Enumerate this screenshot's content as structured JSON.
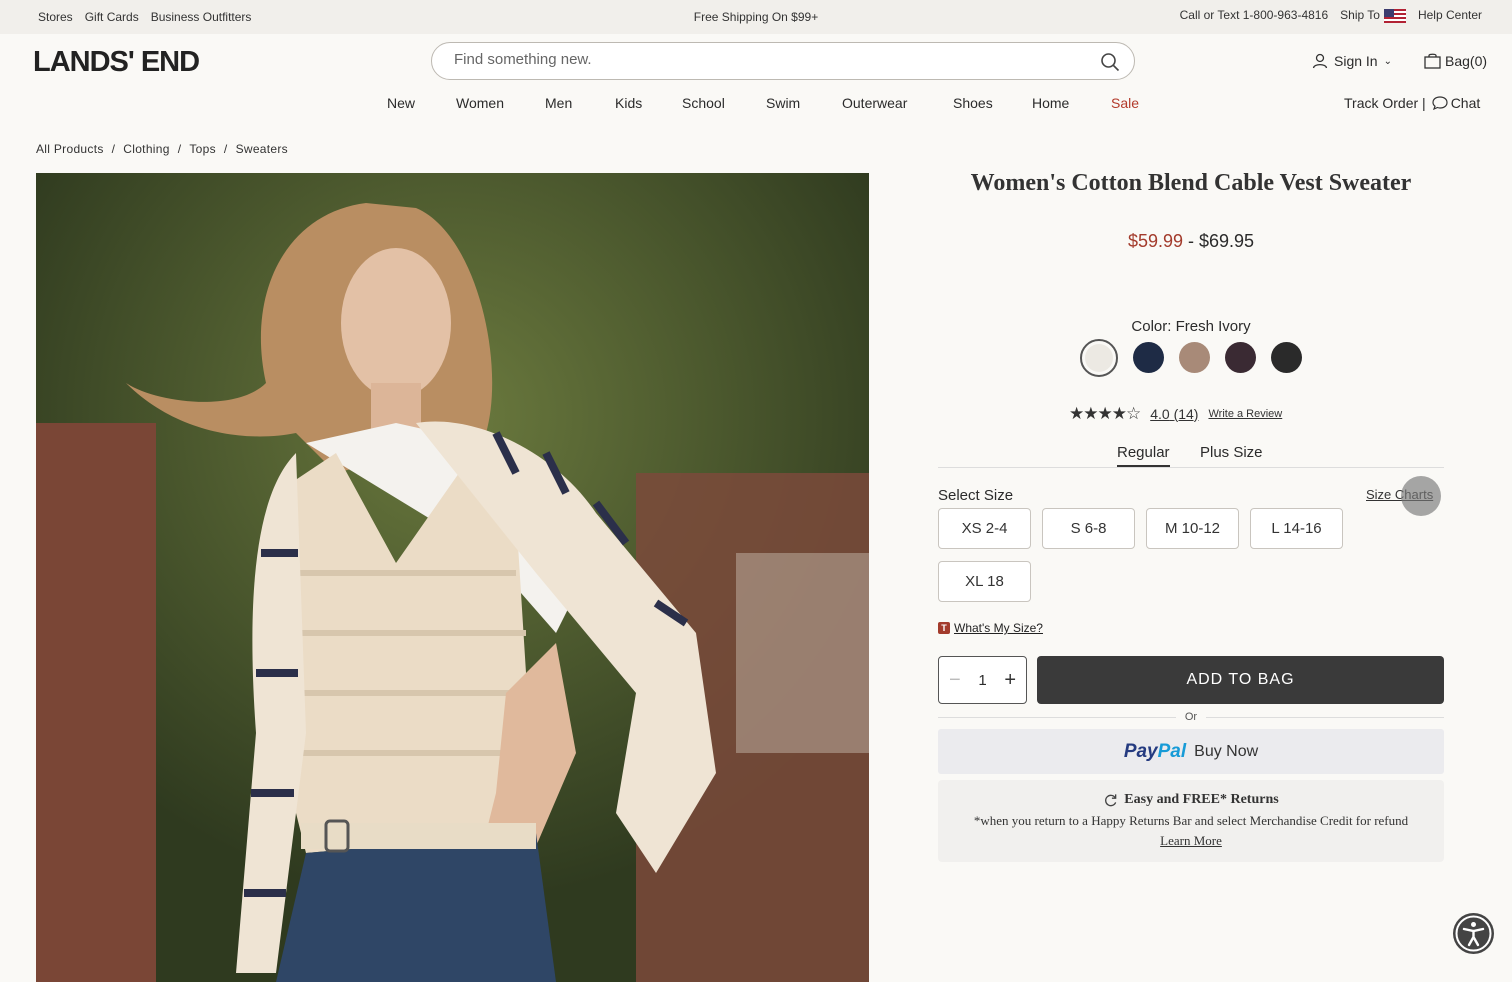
{
  "utility": {
    "links": [
      "Stores",
      "Gift Cards",
      "Business Outfitters"
    ],
    "promo": "Free Shipping On $99+",
    "phone": "Call or Text 1-800-963-4816",
    "ship_to": "Ship To",
    "help": "Help Center"
  },
  "header": {
    "logo": "LANDS' END",
    "search_placeholder": "Find something new.",
    "sign_in": "Sign In",
    "bag": "Bag(0)"
  },
  "nav": {
    "items": [
      "New",
      "Women",
      "Men",
      "Kids",
      "School",
      "Swim",
      "Outerwear",
      "Shoes",
      "Home",
      "Sale"
    ],
    "track_order": "Track Order |",
    "chat": "Chat"
  },
  "breadcrumb": [
    "All Products",
    "/",
    "Clothing",
    "/",
    "Tops",
    "/",
    "Sweaters"
  ],
  "product": {
    "title": "Women's Cotton Blend Cable Vest Sweater",
    "price_low": "$59.99",
    "price_sep": " - ",
    "price_high": "$69.95",
    "color_label": "Color: Fresh Ivory",
    "swatches": [
      "#ece9e3",
      "#1e2b45",
      "#a88a78",
      "#3a2a33",
      "#2a2a2a"
    ],
    "rating_value": "4.0",
    "rating_count": "(14)",
    "stars": "★★★★☆",
    "write_review": "Write a Review",
    "fit_tabs": [
      "Regular",
      "Plus Size"
    ],
    "select_size": "Select Size",
    "size_charts": "Size Charts",
    "sizes": [
      "XS 2-4",
      "S 6-8",
      "M 10-12",
      "L 14-16",
      "XL 18"
    ],
    "whats_my_size": "What's My Size?",
    "whats_badge": "T",
    "qty": "1",
    "add_to_bag": "ADD TO BAG",
    "or": "Or",
    "paypal_1": "Pay",
    "paypal_2": "Pal",
    "buy_now": "Buy Now",
    "returns_title": "Easy and FREE* Returns",
    "returns_note": "*when you return to a Happy Returns Bar and select Merchandise Credit for refund",
    "learn_more": "Learn More"
  },
  "colors": {
    "sale": "#b33a2b",
    "button": "#3a3a3a"
  }
}
